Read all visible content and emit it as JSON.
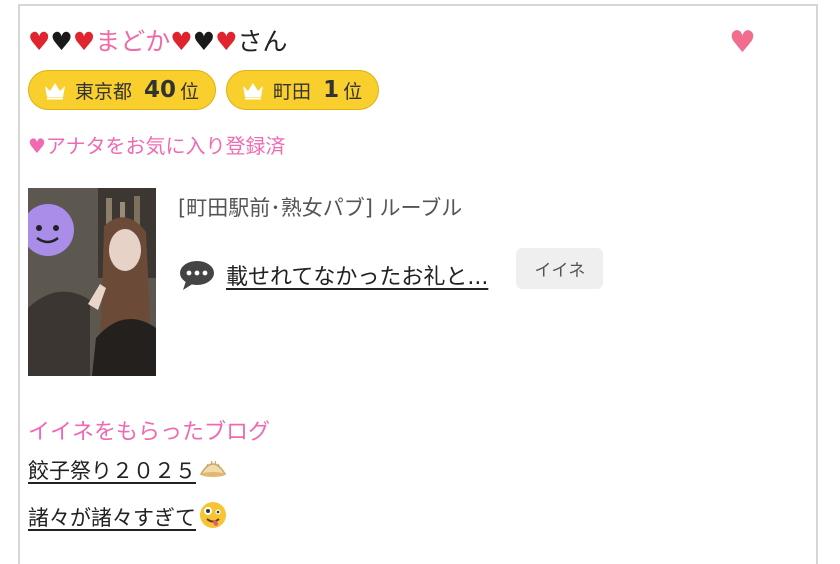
{
  "profile": {
    "name": "まどか",
    "name_suffix": "さん",
    "hearts_before": [
      "red",
      "black",
      "red"
    ],
    "hearts_after": [
      "red",
      "black",
      "red"
    ],
    "favorite_icon": "heart-icon"
  },
  "rankings": [
    {
      "area": "東京都",
      "rank": "40",
      "unit": "位"
    },
    {
      "area": "町田",
      "rank": "1",
      "unit": "位"
    }
  ],
  "favorite_status": "♥アナタをお気に入り登録済",
  "shop": "[町田駅前･熟女パブ]  ルーブル",
  "blog": {
    "title": "載せれてなかったお礼と...",
    "like_label": "イイネ",
    "icon": "speech-bubble-icon"
  },
  "liked_blogs": {
    "heading": "イイネをもらったブログ",
    "items": [
      {
        "title": "餃子祭り２０２５",
        "emoji": "gyoza"
      },
      {
        "title": "諸々が諸々すぎて",
        "emoji": "zany-face"
      }
    ]
  },
  "colors": {
    "pink": "#ef6ab0",
    "badge_yellow": "#f8cf2d",
    "heart_red": "#e0242e"
  }
}
